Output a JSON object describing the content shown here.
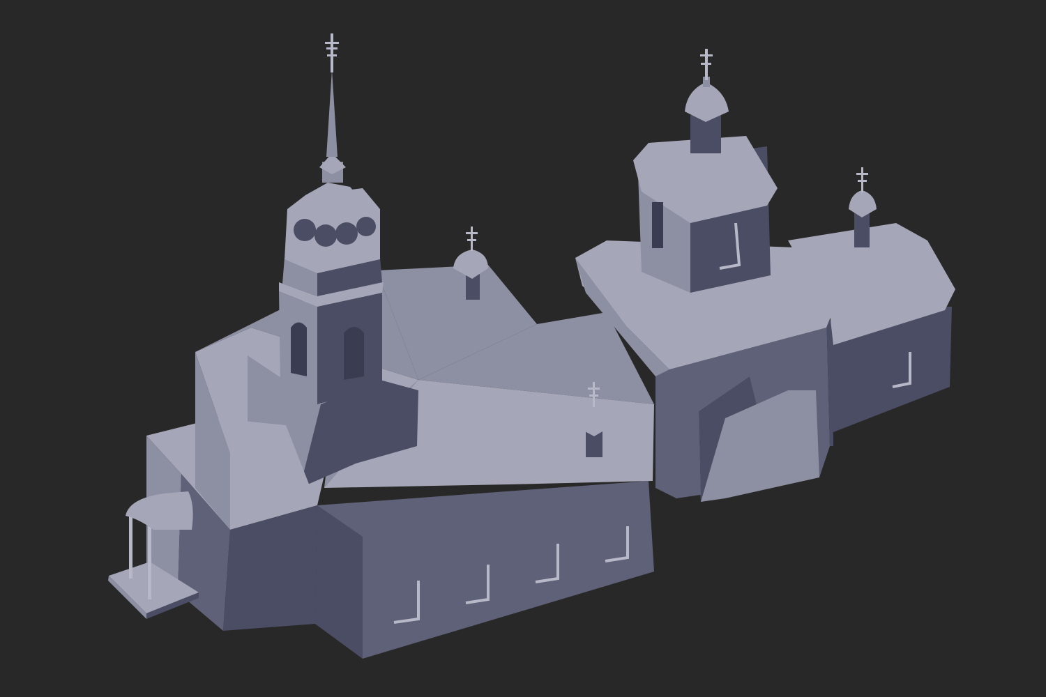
{
  "viewport": {
    "background": "#282828",
    "subject": "church-3d-model-icon",
    "palette": {
      "roof_light": "#a5a6b7",
      "roof_mid": "#8d8fa2",
      "wall_light": "#7b7d93",
      "wall_mid": "#5f6178",
      "wall_dark": "#4b4d64",
      "wall_darkest": "#3a3c52",
      "accent": "#b8b9c8"
    }
  }
}
